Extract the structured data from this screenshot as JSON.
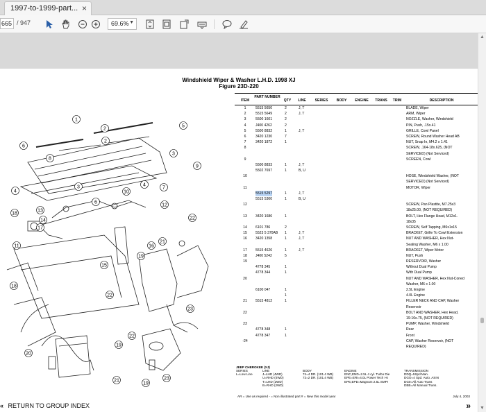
{
  "tab": {
    "title": "1997-to-1999-part...",
    "close": "×"
  },
  "toolbar": {
    "page_current": "665",
    "page_total": "/ 947",
    "zoom": "69.6%"
  },
  "document": {
    "title_line1": "Windshield Wiper & Washer L.H.D. 1998 XJ",
    "title_line2": "Figure 23D-220",
    "headers": {
      "item": "ITEM",
      "part_number": "PART NUMBER",
      "qty": "QTY",
      "line": "LINE",
      "series": "SERIES",
      "body": "BODY",
      "engine": "ENGINE",
      "trans": "TRANS",
      "trim": "TRIM",
      "description": "DESCRIPTION"
    },
    "rows": [
      {
        "item": "1",
        "pn": "5515 5650",
        "qty": "2",
        "line": "J, T",
        "desc": "BLADE, Wiper"
      },
      {
        "item": "2",
        "pn": "5515 5649",
        "qty": "2",
        "line": "J, T",
        "desc": "ARM, Wiper"
      },
      {
        "item": "3",
        "pn": "5500 1601",
        "qty": "2",
        "line": "",
        "desc": "NOZZLE, Washer, Windshield"
      },
      {
        "item": "4",
        "pn": "J400 4262",
        "qty": "2",
        "line": "",
        "desc": "PIN, Push, .15x.41"
      },
      {
        "item": "5",
        "pn": "5500 8832",
        "qty": "1",
        "line": "J, T",
        "desc": "GRILLE, Cowl Panel"
      },
      {
        "item": "6",
        "pn": "3420 1230",
        "qty": "7",
        "line": "",
        "desc": "SCREW, Round Washer Head AB"
      },
      {
        "item": "7",
        "pn": "3420 1872",
        "qty": "1",
        "line": "",
        "desc": "NUT, Snap In, M4.2 x 1.41"
      },
      {
        "item": "8",
        "pn": "",
        "qty": "",
        "line": "",
        "desc": "SCREW, .164-18x.625, (NOT"
      },
      {
        "item": "",
        "pn": "",
        "qty": "",
        "line": "",
        "desc": "   SERVICED) (Not Serviced)"
      },
      {
        "item": "9",
        "pn": "",
        "qty": "",
        "line": "",
        "desc": "SCREEN, Cowl"
      },
      {
        "item": "",
        "pn": "5500 8833",
        "qty": "1",
        "line": "J, T",
        "desc": ""
      },
      {
        "item": "",
        "pn": "5502 7697",
        "qty": "1",
        "line": "B, U",
        "desc": ""
      },
      {
        "item": "10",
        "pn": "",
        "qty": "",
        "line": "",
        "desc": "HOSE, Windshield Washer, (NOT"
      },
      {
        "item": "",
        "pn": "",
        "qty": "",
        "line": "",
        "desc": "   SERVICED) (Not Serviced)"
      },
      {
        "item": "11",
        "pn": "",
        "qty": "",
        "line": "",
        "desc": "MOTOR, Wiper"
      },
      {
        "item": "",
        "pn": "5515 5297",
        "qty": "1",
        "line": "J, T",
        "desc": "",
        "highlight": true
      },
      {
        "item": "",
        "pn": "5515 5300",
        "qty": "1",
        "line": "B, U",
        "desc": ""
      },
      {
        "item": "12",
        "pn": "",
        "qty": "",
        "line": "",
        "desc": "SCREW, Pan Plastite, M7.25x3"
      },
      {
        "item": "",
        "pn": "",
        "qty": "",
        "line": "",
        "desc": "   18x25.00, (NOT REQUIRED)"
      },
      {
        "item": "13",
        "pn": "3420 1686",
        "qty": "1",
        "line": "",
        "desc": "BOLT, Hex Flange Head, M12x1."
      },
      {
        "item": "",
        "pn": "",
        "qty": "",
        "line": "",
        "desc": "   18x35"
      },
      {
        "item": "14",
        "pn": "6101 786",
        "qty": "2",
        "line": "",
        "desc": "SCREW, Self Tapping, M6x1x15"
      },
      {
        "item": "15",
        "pn": "5523 5 370AB",
        "qty": "1",
        "line": "J, T",
        "desc": "BRACKET, Grille To Cowl Extension"
      },
      {
        "item": "16",
        "pn": "3420 1358",
        "qty": "1",
        "line": "J, T",
        "desc": "NUT AND WASHER, Hex Nut-"
      },
      {
        "item": "",
        "pn": "",
        "qty": "",
        "line": "",
        "desc": "   Sealing Washer, M6 x 1.00"
      },
      {
        "item": "17",
        "pn": "5515 4626",
        "qty": "1",
        "line": "J, T",
        "desc": "BRACKET, Wiper Motor"
      },
      {
        "item": "18",
        "pn": "J400 5242",
        "qty": "5",
        "line": "",
        "desc": "NUT, Push"
      },
      {
        "item": "19",
        "pn": "",
        "qty": "",
        "line": "",
        "desc": "RESERVOIR, Washer"
      },
      {
        "item": "",
        "pn": "4778 345",
        "qty": "1",
        "line": "",
        "desc": "   Without Dual Pump"
      },
      {
        "item": "",
        "pn": "4778 344",
        "qty": "1",
        "line": "",
        "desc": "   With Dual Pump"
      },
      {
        "item": "20",
        "pn": "",
        "qty": "",
        "line": "",
        "desc": "NUT AND WASHER, Hex Nut-Coned"
      },
      {
        "item": "",
        "pn": "",
        "qty": "",
        "line": "",
        "desc": "   Washer, M6 x 1.00"
      },
      {
        "item": "",
        "pn": "6100 047",
        "qty": "1",
        "line": "",
        "desc": "   2.5L Engine"
      },
      {
        "item": "",
        "pn": "",
        "qty": "1",
        "line": "",
        "desc": "   4.0L Engine"
      },
      {
        "item": "21",
        "pn": "5515 4812",
        "qty": "1",
        "line": "",
        "desc": "FILLER NECK AND CAP, Washer"
      },
      {
        "item": "",
        "pn": "",
        "qty": "",
        "line": "",
        "desc": "   Reservoir"
      },
      {
        "item": "22",
        "pn": "",
        "qty": "",
        "line": "",
        "desc": "BOLT AND WASHER, Hex Head,"
      },
      {
        "item": "",
        "pn": "",
        "qty": "",
        "line": "",
        "desc": "   19-16x.75, (NOT REQUIRED)"
      },
      {
        "item": "23",
        "pn": "",
        "qty": "",
        "line": "",
        "desc": "PUMP, Washer, Windshield"
      },
      {
        "item": "",
        "pn": "4778 348",
        "qty": "1",
        "line": "",
        "desc": "   Rear"
      },
      {
        "item": "",
        "pn": "4778 347",
        "qty": "1",
        "line": "",
        "desc": "   Front"
      },
      {
        "item": "-24",
        "pn": "",
        "qty": "",
        "line": "",
        "desc": "CAP, Washer Reservoir, (NOT"
      },
      {
        "item": "",
        "pn": "",
        "qty": "",
        "line": "",
        "desc": "   REQUIRED)"
      }
    ],
    "legend": {
      "model": "JEEP CHEROKEE (XJ)",
      "series": "SERIES\nL=Low Line",
      "line": "LINE\nJ=LHD (4WD)\nU=RHD (4WD)\nT=LHD (2WD)\nB=RHD (2WD)",
      "body": "BODY\n74=4 DR. (101.4 WB)\n72=2 DR. (101.4 WB)",
      "engine": "ENGINE\nENC,END=2.5L 4 cyl. Turbo Die\nEPE=ERI=4.0L Power Tech I-6\nEPE,EPD=Magnum 2.5L SMPI",
      "trans": "TRANSMISSION\nDDQ=5Spd Man.\nDGO=4 Spd. Auto. ASIN\nDG0=All Auto Trans\nDBB=All Manual Trans."
    },
    "footer": {
      "notes": "AR = Use as required    - = Non illustrated part    # = New this model year",
      "date": "July 4, 2003"
    }
  },
  "nav": {
    "back": "RETURN TO GROUP INDEX",
    "next": "»",
    "back_arrow": "«"
  },
  "callouts": [
    "1",
    "2",
    "3",
    "4",
    "5",
    "6",
    "7",
    "8",
    "9",
    "10",
    "11",
    "12",
    "13",
    "14",
    "15",
    "16",
    "17",
    "18",
    "19",
    "20",
    "21",
    "22",
    "23"
  ]
}
